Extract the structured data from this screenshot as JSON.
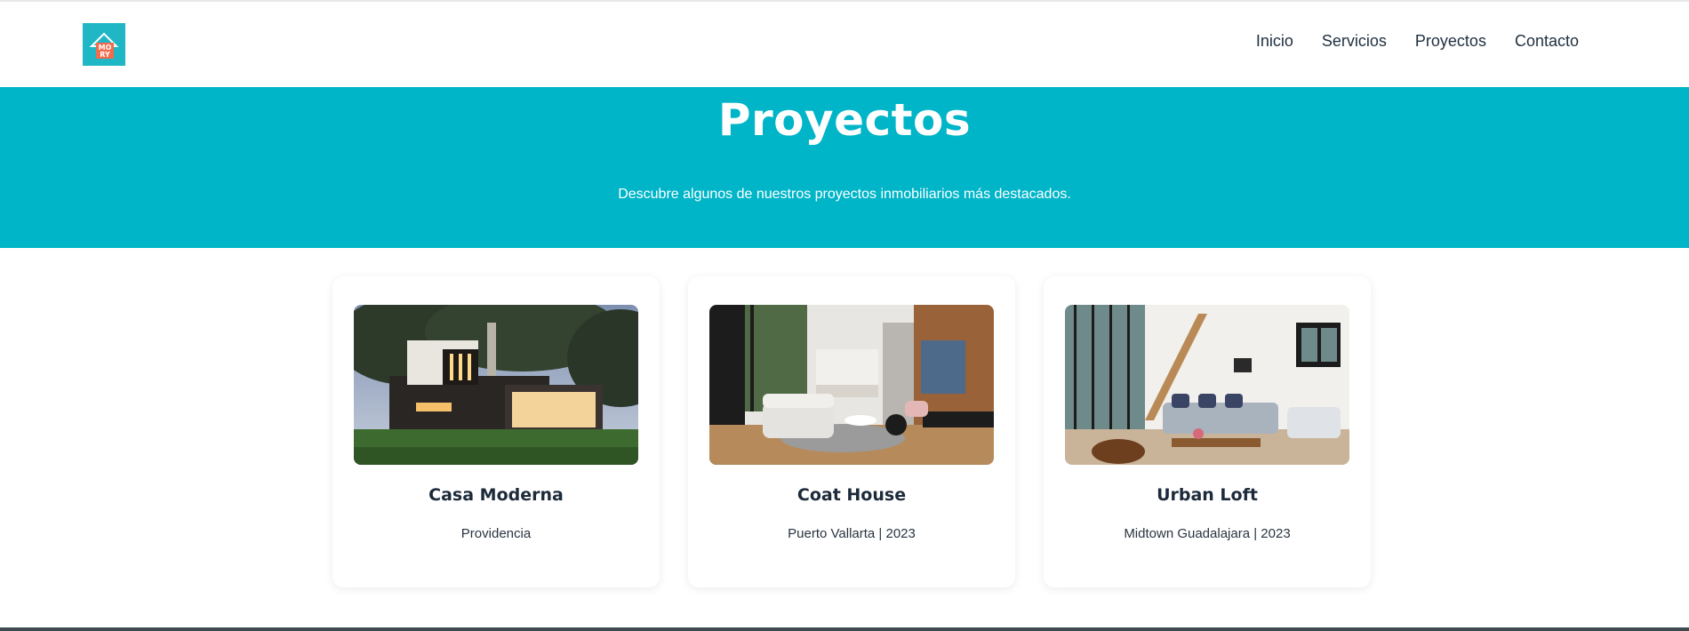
{
  "brand": {
    "logo_text_top": "MO",
    "logo_text_bottom": "RY",
    "accent": "#00b5c8"
  },
  "nav": {
    "items": [
      {
        "label": "Inicio"
      },
      {
        "label": "Servicios"
      },
      {
        "label": "Proyectos"
      },
      {
        "label": "Contacto"
      }
    ]
  },
  "hero": {
    "title": "Proyectos",
    "subtitle": "Descubre algunos de nuestros proyectos inmobiliarios más destacados."
  },
  "projects": [
    {
      "title": "Casa Moderna",
      "location": "Providencia"
    },
    {
      "title": "Coat House",
      "location": "Puerto Vallarta | 2023"
    },
    {
      "title": "Urban Loft",
      "location": "Midtown Guadalajara | 2023"
    }
  ]
}
